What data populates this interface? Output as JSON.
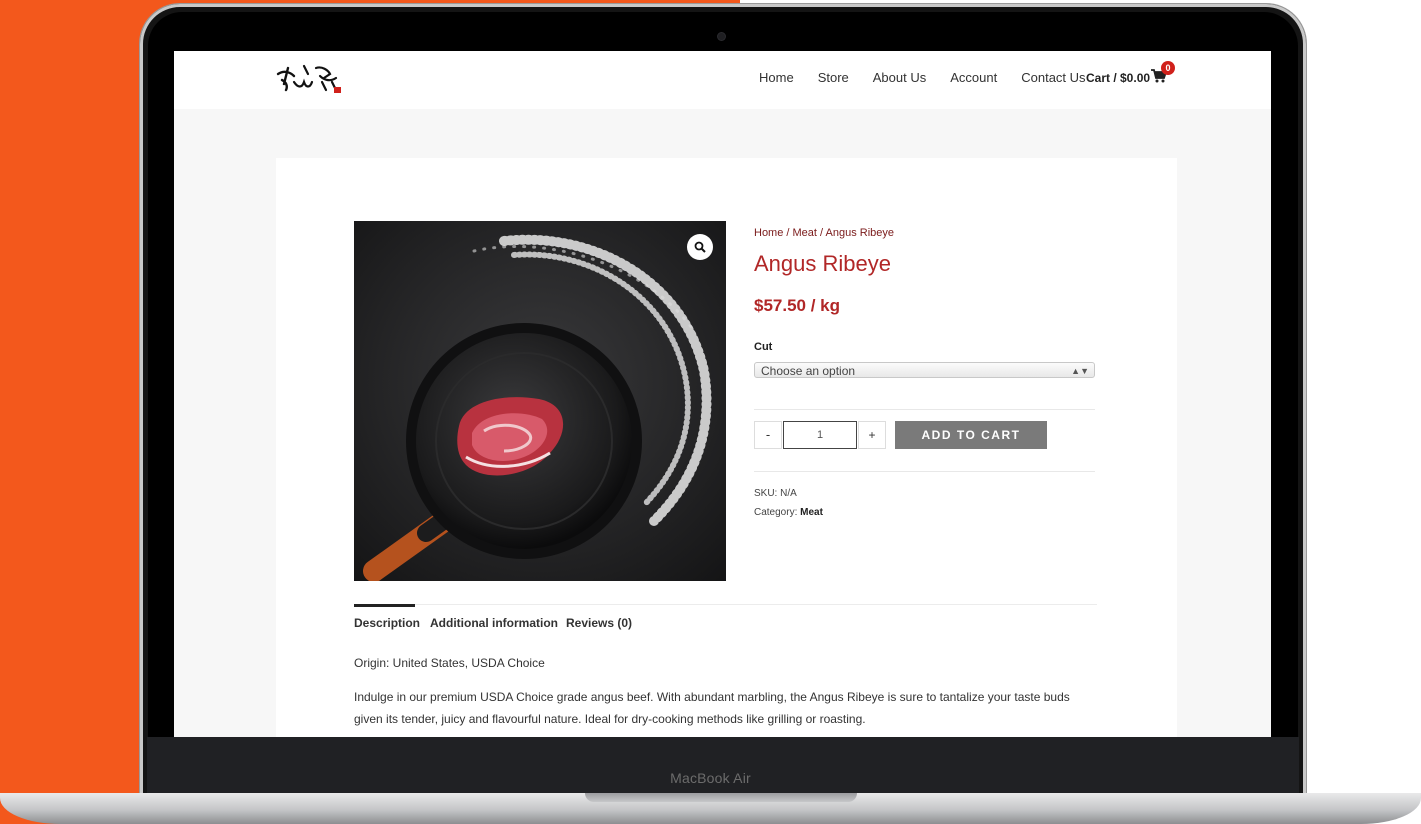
{
  "device": {
    "label": "MacBook Air"
  },
  "colors": {
    "background_accent": "#f3581c",
    "brand_red": "#b12727",
    "button_gray": "#7a7a7a"
  },
  "header": {
    "logo_icon": "bull-logo-icon",
    "nav": [
      "Home",
      "Store",
      "About Us",
      "Account",
      "Contact Us"
    ],
    "cart_label": "Cart / $0.00",
    "cart_count": "0",
    "cart_icon": "shopping-cart-icon"
  },
  "product": {
    "breadcrumb": "Home / Meat / Angus Ribeye",
    "title": "Angus Ribeye",
    "price": "$57.50 / kg",
    "cut_label": "Cut",
    "cut_value": "Choose an option",
    "cut_arrows": "▲▼",
    "qty_minus": "-",
    "qty_value": "1",
    "qty_plus": "+",
    "add_to_cart": "ADD TO CART",
    "sku_label": "SKU:",
    "sku_value": "N/A",
    "category_label": "Category:",
    "category_value": "Meat",
    "zoom_icon": "magnifier-icon"
  },
  "tabs": [
    "Description",
    "Additional information",
    "Reviews (0)"
  ],
  "description": {
    "origin": "Origin: United States, USDA Choice",
    "body": "Indulge in our premium USDA Choice grade angus beef. With abundant marbling, the Angus Ribeye is sure to tantalize your taste buds given its tender, juicy and flavourful nature. Ideal for dry-cooking methods like grilling or roasting."
  }
}
